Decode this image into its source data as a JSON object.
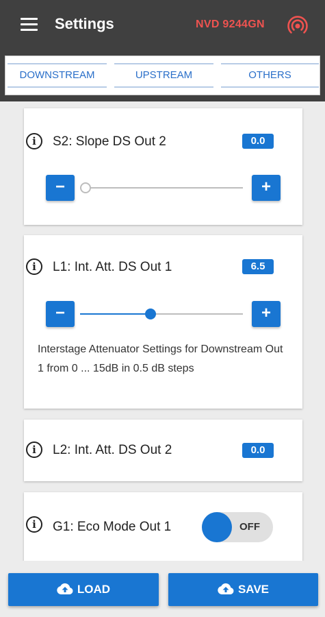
{
  "header": {
    "title": "Settings",
    "device_id": "NVD 9244GN",
    "icons": [
      "menu-icon",
      "signal-icon"
    ]
  },
  "tabs": [
    {
      "label": "DOWNSTREAM"
    },
    {
      "label": "UPSTREAM"
    },
    {
      "label": "OTHERS"
    }
  ],
  "settings": [
    {
      "title": "S2: Slope DS Out 2",
      "value": "0.0",
      "min": 0,
      "max": 15,
      "level": 0.0,
      "minus": "−",
      "plus": "+"
    },
    {
      "title": "L1: Int. Att. DS Out 1",
      "value": "6.5",
      "min": 0,
      "max": 15,
      "level": 6.5,
      "minus": "−",
      "plus": "+",
      "description": "Interstage Attenuator Settings for Downstream Out 1 from 0 ... 15dB in 0.5 dB steps"
    },
    {
      "title": "L2: Int. Att. DS Out 2",
      "value": "0.0"
    },
    {
      "title": "G1: Eco Mode Out 1",
      "toggle_state": "OFF"
    }
  ],
  "info_glyph": "i",
  "actions": {
    "load_label": "LOAD",
    "save_label": "SAVE"
  },
  "colors": {
    "primary": "#1976d2",
    "appbar": "#404040",
    "device_id": "#ef5350",
    "background": "#ececec"
  }
}
